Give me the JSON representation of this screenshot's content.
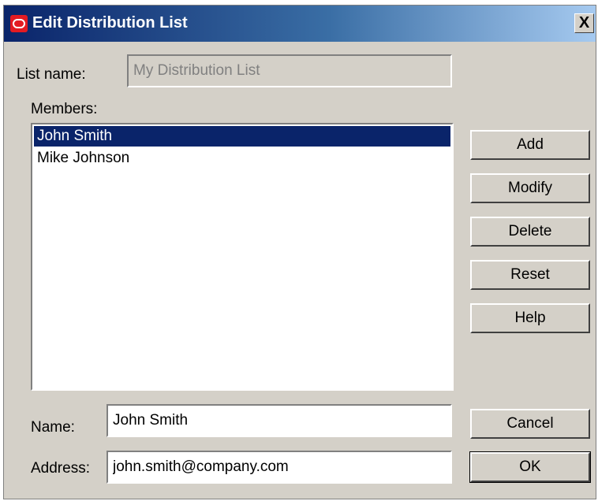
{
  "window": {
    "title": "Edit Distribution List",
    "close_label": "X"
  },
  "form": {
    "list_name_label": "List name:",
    "list_name_value": "My Distribution List",
    "members_label": "Members:",
    "name_label": "Name:",
    "name_value": "John Smith",
    "address_label": "Address:",
    "address_value": "john.smith@company.com"
  },
  "members": [
    {
      "label": "John Smith",
      "selected": true
    },
    {
      "label": "Mike Johnson",
      "selected": false
    }
  ],
  "buttons": {
    "add": "Add",
    "modify": "Modify",
    "delete": "Delete",
    "reset": "Reset",
    "help": "Help",
    "cancel": "Cancel",
    "ok": "OK"
  },
  "colors": {
    "title_bar_start": "#0a246a",
    "selection": "#0a246a",
    "dialog_bg": "#d4d0c8",
    "app_icon": "#e31b23"
  }
}
